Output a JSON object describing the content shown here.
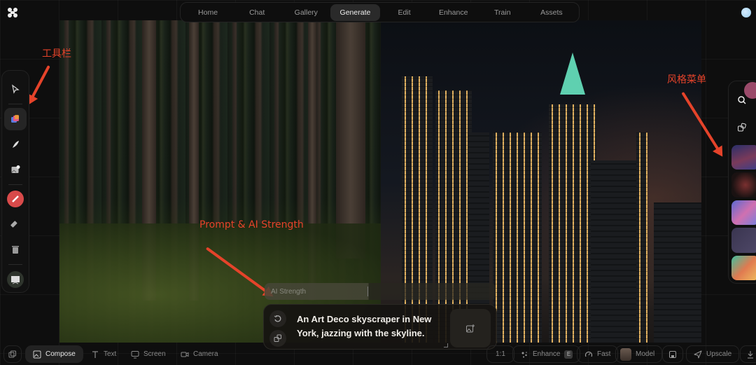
{
  "app": {
    "logo": "logo-icon"
  },
  "topnav": {
    "tabs": [
      {
        "label": "Home",
        "active": false
      },
      {
        "label": "Chat",
        "active": false
      },
      {
        "label": "Gallery",
        "active": false
      },
      {
        "label": "Generate",
        "active": true
      },
      {
        "label": "Edit",
        "active": false
      },
      {
        "label": "Enhance",
        "active": false
      },
      {
        "label": "Train",
        "active": false
      },
      {
        "label": "Assets",
        "active": false
      }
    ]
  },
  "toolbar": {
    "tools": [
      {
        "name": "select",
        "icon": "pointer-icon",
        "active": false
      },
      {
        "name": "generate",
        "icon": "layers-icon",
        "active": true
      },
      {
        "name": "brush",
        "icon": "feather-icon",
        "active": false
      },
      {
        "name": "add-image",
        "icon": "image-add-icon",
        "active": false
      },
      {
        "name": "draw",
        "icon": "pencil-icon",
        "active": false
      },
      {
        "name": "eraser",
        "icon": "eraser-icon",
        "active": false
      },
      {
        "name": "delete",
        "icon": "trash-icon",
        "active": false
      },
      {
        "name": "canvas",
        "icon": "easel-icon",
        "active": false
      }
    ]
  },
  "stylemenu": {
    "search_icon": "search-icon",
    "random_icon": "dice-icon",
    "styles": [
      {
        "name": "style-1",
        "colors": [
          "#3b3f7a",
          "#b0567a"
        ]
      },
      {
        "name": "style-2",
        "colors": [
          "#1a1a1a",
          "#8a3a3a"
        ]
      },
      {
        "name": "style-3",
        "colors": [
          "#6a7ad0",
          "#d070a0"
        ]
      },
      {
        "name": "style-4",
        "colors": [
          "#3a3550",
          "#5a5270"
        ]
      },
      {
        "name": "style-5",
        "colors": [
          "#40c0a0",
          "#e06050"
        ]
      }
    ]
  },
  "annotations": {
    "toolbar": "工具栏",
    "stylemenu": "风格菜单",
    "prompt": "Prompt & AI Strength"
  },
  "prompt": {
    "strength_label": "AI Strength",
    "strength_value": 0.45,
    "text": "An Art Deco skyscraper in New York, jazzing with the skyline.",
    "reset_icon": "reset-icon",
    "random_icon": "dice-icon",
    "image_button_icon": "image-add-icon"
  },
  "bottombar": {
    "left": {
      "layers_icon": "copy-icon",
      "modes": [
        {
          "label": "Compose",
          "icon": "image-icon",
          "active": true
        },
        {
          "label": "Text",
          "icon": "text-icon",
          "active": false
        },
        {
          "label": "Screen",
          "icon": "monitor-icon",
          "active": false
        },
        {
          "label": "Camera",
          "icon": "camera-icon",
          "active": false
        }
      ]
    },
    "right": {
      "ratio": "1:1",
      "enhance": "Enhance",
      "enhance_key": "E",
      "speed": "Fast",
      "model": "Model",
      "upscale": "Upscale"
    }
  }
}
